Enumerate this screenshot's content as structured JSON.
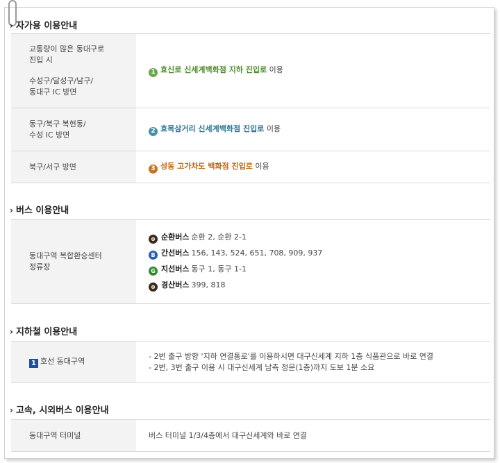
{
  "sections": {
    "car": {
      "title": "자가용 이용안내",
      "rows": [
        {
          "head_lines": [
            "교통량이 많은 동대구로",
            "진입 시"
          ],
          "head_lines2": [
            "수성구/달성구/남구/",
            "동대구 IC 방면"
          ],
          "num": "1",
          "route": "효신로 신세계백화점 지하 진입로",
          "suffix": " 이용"
        },
        {
          "head_lines": [
            "동구/북구 복현동/",
            "수성 IC 방면"
          ],
          "num": "2",
          "route": "효목삼거리 신세계백화점 진입로",
          "suffix": " 이용"
        },
        {
          "head_lines": [
            "북구/서구 방면"
          ],
          "num": "3",
          "route": "성동 고가차도 백화점 진입로",
          "suffix": " 이용"
        }
      ]
    },
    "bus": {
      "title": "버스 이용안내",
      "head_lines": [
        "동대구역 복합환승센터",
        "정류장"
      ],
      "lines": [
        {
          "icon": "circular-bus-icon",
          "glyph": "⊜",
          "name": "순환버스",
          "routes": "순환 2, 순환 2-1"
        },
        {
          "icon": "trunk-bus-icon",
          "glyph": "B",
          "name": "간선버스",
          "routes": "156, 143, 524, 651, 708, 909, 937"
        },
        {
          "icon": "branch-bus-icon",
          "glyph": "G",
          "name": "지선버스",
          "routes": "동구 1, 동구 1-1"
        },
        {
          "icon": "gyeongsan-bus-icon",
          "glyph": "⊜",
          "name": "경산버스",
          "routes": "399, 818"
        }
      ]
    },
    "subway": {
      "title": "지하철 이용안내",
      "line_num": "1",
      "station": "호선 동대구역",
      "notes": [
        "- 2번 출구 방향 '지하 연결통로'를 이용하시면 대구신세계 지하 1층 식품관으로 바로 연결",
        "- 2번, 3번 출구 이용 시 대구신세계 남측 정문(1층)까지 도보 1분 소요"
      ]
    },
    "express": {
      "title": "고속, 시외버스 이용안내",
      "head": "동대구역 터미널",
      "note": "버스 터미널 1/3/4층에서 대구신세계와 바로 연결"
    }
  },
  "arrow_glyph": "›"
}
